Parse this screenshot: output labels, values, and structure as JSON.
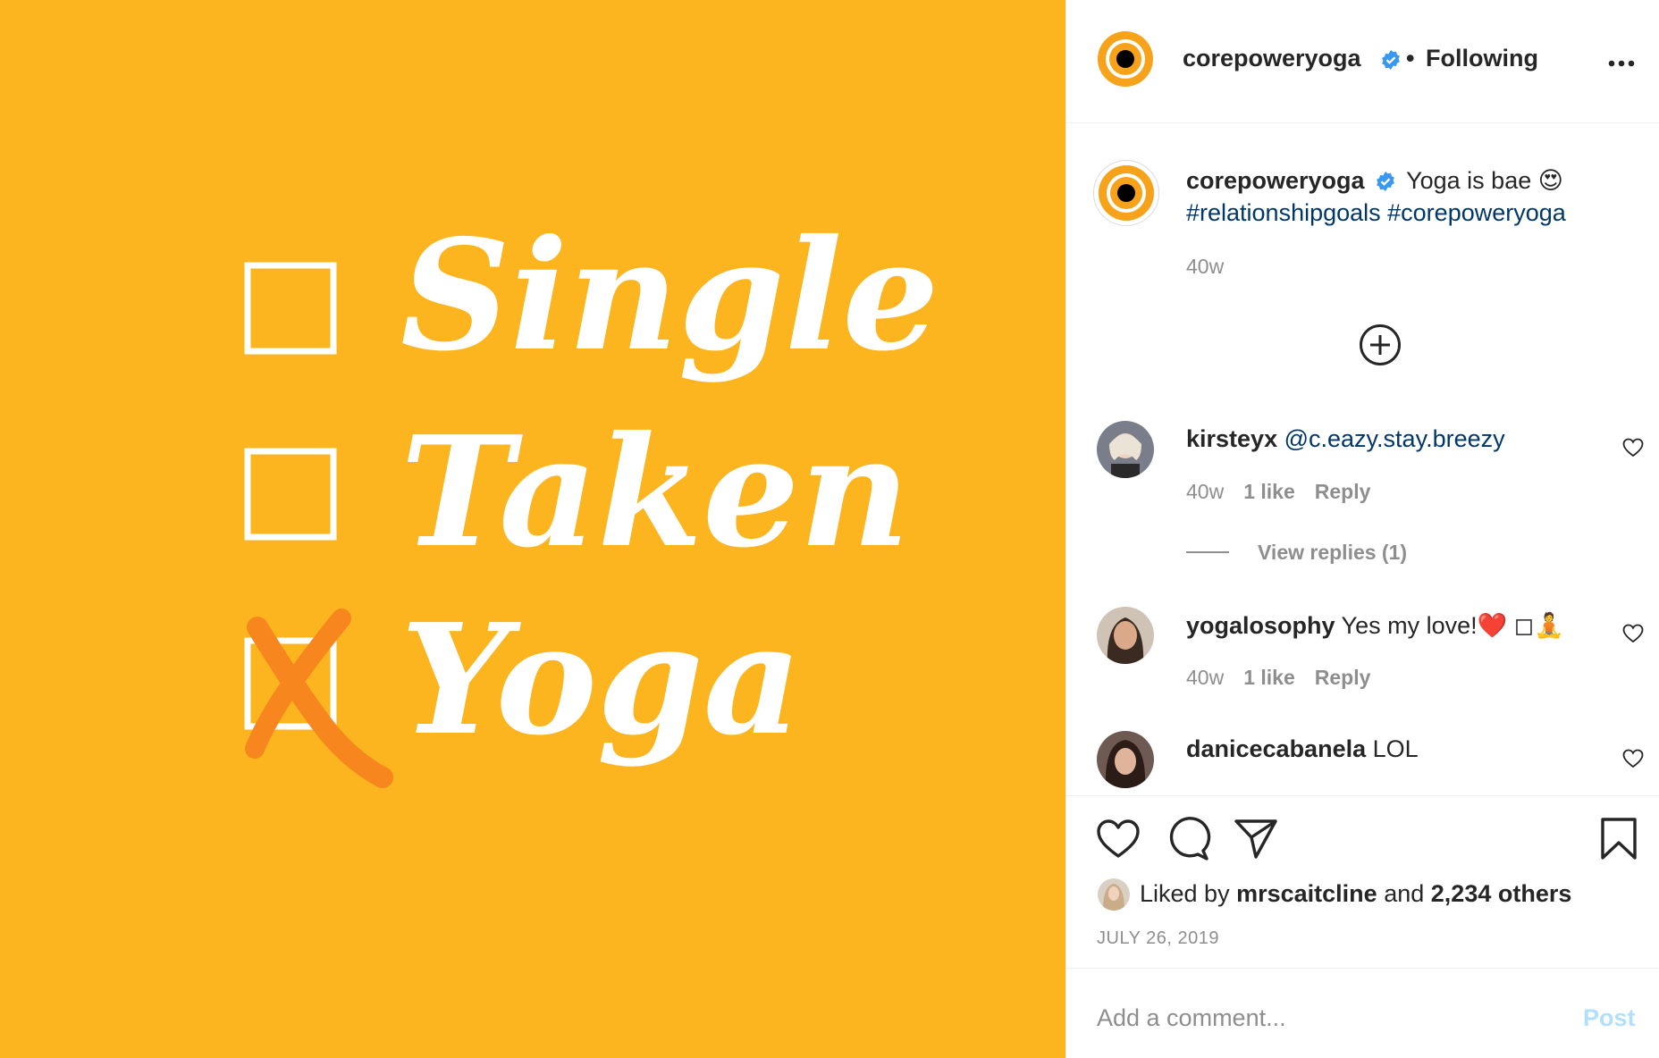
{
  "post_image": {
    "words": [
      "Single",
      "Taken",
      "Yoga"
    ],
    "bg_color": "#fcb41f",
    "check_color": "#f7861f"
  },
  "header": {
    "username": "corepoweryoga",
    "separator": "•",
    "follow_status": "Following",
    "more_icon": "more-horizontal-icon"
  },
  "caption": {
    "username": "corepoweryoga",
    "text": "Yoga is bae",
    "emoji": "😍",
    "hashtags": "#relationshipgoals #corepoweryoga",
    "time": "40w"
  },
  "comments": [
    {
      "username": "kirsteyx",
      "text": "@c.eazy.stay.breezy",
      "time": "40w",
      "likes": "1 like",
      "reply": "Reply",
      "view_replies": "View replies (1)"
    },
    {
      "username": "yogalosophy",
      "text": "Yes my love!",
      "emoji": "❤️ ◻🧘",
      "time": "40w",
      "likes": "1 like",
      "reply": "Reply"
    },
    {
      "username": "danicecabanela",
      "text": "LOL"
    }
  ],
  "likes": {
    "prefix": "Liked by",
    "user": "mrscaitcline",
    "and": "and",
    "others": "2,234 others"
  },
  "date": "JULY 26, 2019",
  "comment_box": {
    "placeholder": "Add a comment...",
    "post_label": "Post"
  },
  "colors": {
    "link": "#00376b",
    "muted": "#8e8e8e",
    "verified": "#3897f0",
    "post_disabled": "#b2dffc"
  }
}
